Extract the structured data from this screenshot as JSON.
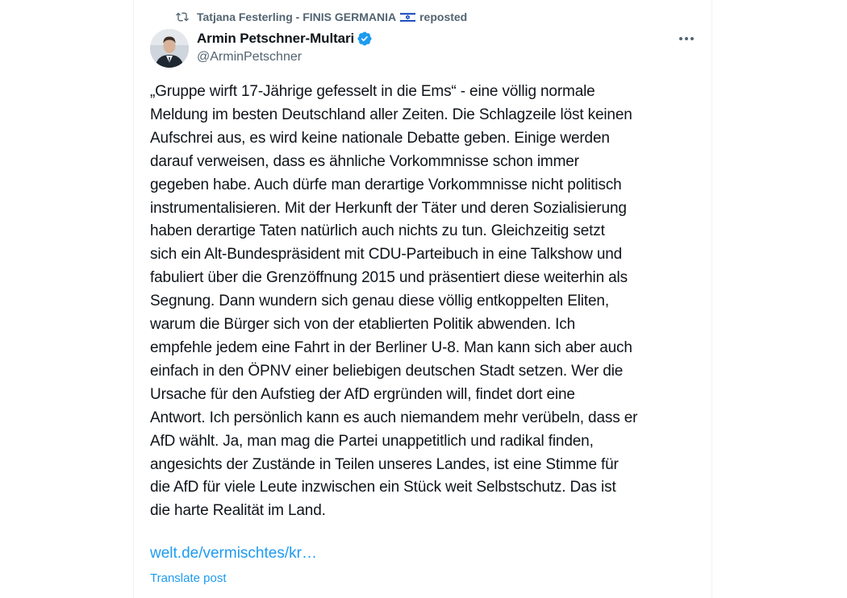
{
  "repost": {
    "user": "Tatjana Festerling - FINIS GERMANIA",
    "flag_icon": "israel-flag-icon",
    "action": "reposted"
  },
  "author": {
    "name": "Armin Petschner-Multari",
    "handle": "@ArminPetschner",
    "verified": true
  },
  "post": {
    "lines": [
      "„Gruppe wirft 17-Jährige gefesselt in die Ems“ - eine völlig normale",
      "Meldung im besten Deutschland aller Zeiten. Die Schlagzeile löst keinen",
      "Aufschrei aus, es wird keine nationale Debatte geben. Einige werden",
      "darauf verweisen, dass es ähnliche Vorkommnisse schon immer",
      "gegeben habe. Auch dürfe man derartige Vorkommnisse nicht politisch",
      "instrumentalisieren. Mit der Herkunft der Täter und deren Sozialisierung",
      "haben derartige Taten natürlich auch nichts zu tun. Gleichzeitig setzt",
      "sich ein Alt-Bundespräsident mit CDU-Parteibuch in eine Talkshow und",
      "fabuliert über die Grenzöffnung 2015 und präsentiert diese weiterhin als",
      "Segnung. Dann wundern sich genau diese völlig entkoppelten Eliten,",
      "warum die Bürger sich von der etablierten Politik abwenden. Ich",
      "empfehle jedem eine Fahrt in der Berliner U-8. Man kann sich aber auch",
      "einfach in den ÖPNV einer beliebigen deutschen Stadt setzen. Wer die",
      "Ursache für den Aufstieg der AfD ergründen will, findet dort eine",
      "Antwort. Ich persönlich kann es auch niemandem mehr verübeln, dass er",
      "AfD wählt. Ja, man mag die Partei unappetitlich und radikal finden,",
      "angesichts der Zustände in Teilen unseres Landes, ist eine Stimme für",
      "die AfD für viele Leute inzwischen ein Stück weit Selbstschutz. Das ist",
      "die harte Realität im Land."
    ],
    "link": "welt.de/vermischtes/kr…",
    "translate_label": "Translate post"
  },
  "colors": {
    "text": "#0f1419",
    "secondary": "#536471",
    "accent": "#1d9bf0"
  },
  "icons": {
    "repost": "repost-icon",
    "verified": "verified-badge-icon",
    "more": "more-options-icon"
  }
}
